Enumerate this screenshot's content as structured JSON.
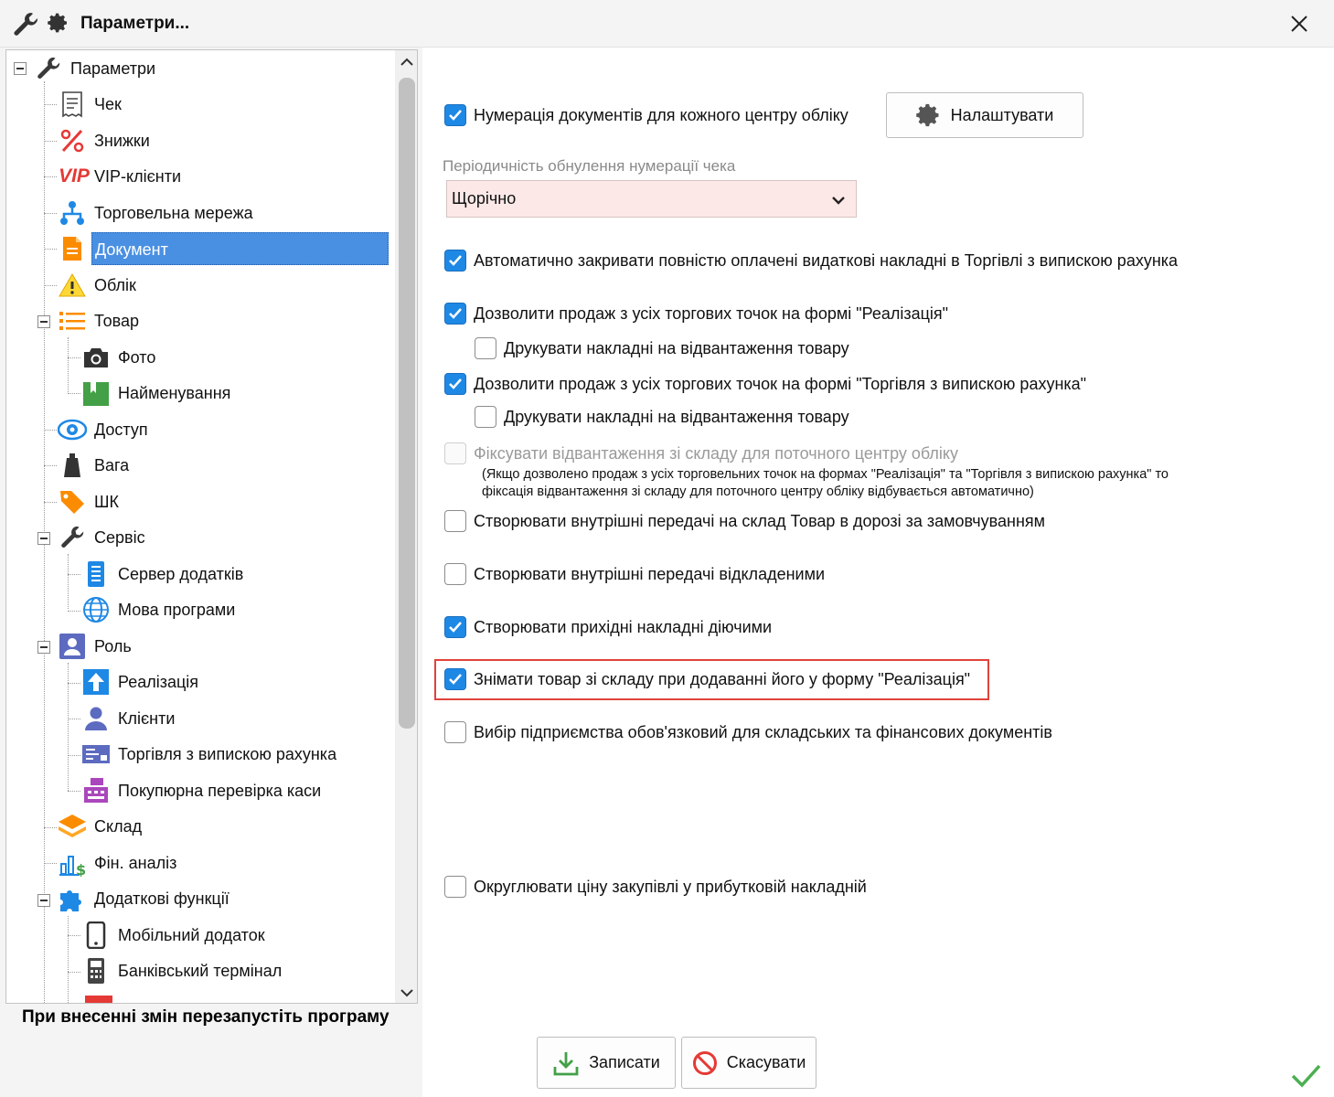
{
  "window": {
    "title": "Параметри...",
    "icons": [
      "wrench-icon",
      "gear-icon",
      "close-icon"
    ]
  },
  "tree": {
    "items": [
      {
        "label": "Параметри",
        "icon": "wrench-icon"
      },
      {
        "label": "Чек",
        "icon": "receipt-icon"
      },
      {
        "label": "Знижки",
        "icon": "percent-icon"
      },
      {
        "label": "VIP-клієнти",
        "icon": "vip-icon",
        "icon_text": "VIP"
      },
      {
        "label": "Торговельна мережа",
        "icon": "network-icon"
      },
      {
        "label": "Документ",
        "icon": "document-icon",
        "selected": true
      },
      {
        "label": "Облік",
        "icon": "warning-icon"
      },
      {
        "label": "Товар",
        "icon": "list-icon"
      },
      {
        "label": "Фото",
        "icon": "camera-icon"
      },
      {
        "label": "Найменування",
        "icon": "name-tag-icon"
      },
      {
        "label": "Доступ",
        "icon": "eye-icon"
      },
      {
        "label": "Вага",
        "icon": "weight-icon"
      },
      {
        "label": "ШК",
        "icon": "tag-icon"
      },
      {
        "label": "Сервіс",
        "icon": "wrench-icon"
      },
      {
        "label": "Сервер додатків",
        "icon": "server-icon"
      },
      {
        "label": "Мова програми",
        "icon": "globe-icon"
      },
      {
        "label": "Роль",
        "icon": "user-card-icon"
      },
      {
        "label": "Реалізація",
        "icon": "upload-icon"
      },
      {
        "label": "Клієнти",
        "icon": "user-icon"
      },
      {
        "label": "Торгівля з випискою рахунка",
        "icon": "invoice-icon"
      },
      {
        "label": "Покупюрна перевірка каси",
        "icon": "cash-register-icon"
      },
      {
        "label": "Склад",
        "icon": "layers-icon"
      },
      {
        "label": "Фін. аналіз",
        "icon": "chart-dollar-icon"
      },
      {
        "label": "Додаткові функції",
        "icon": "puzzle-icon"
      },
      {
        "label": "Мобільний додаток",
        "icon": "phone-icon"
      },
      {
        "label": "Банківський термінал",
        "icon": "terminal-icon"
      }
    ]
  },
  "restart_note": "При внесенні змін перезапустіть програму",
  "settings": {
    "numbering_label": "Нумерація документів для кожного центру обліку",
    "numbering_checked": true,
    "configure_button": "Налаштувати",
    "period_label": "Періодичність обнулення нумерації чека",
    "period_value": "Щорічно",
    "auto_close_label": "Автоматично закривати повністю оплачені видаткові накладні в Торгівлі з випискою рахунка",
    "allow_sale_realization_label": "Дозволити продаж з усіх торгових точок на формі \"Реалізація\"",
    "print_invoices_1_label": "Друкувати накладні на відвантаження товару",
    "allow_sale_trade_label": "Дозволити продаж з усіх торгових точок на формі \"Торгівля з випискою рахунка\"",
    "print_invoices_2_label": "Друкувати накладні на відвантаження товару",
    "fix_shipment_label": "Фіксувати відвантаження зі складу для поточного центру обліку",
    "fix_shipment_note_1": "(Якщо дозволено продаж з усіх торговельних точок на формах \"Реалізація\" та \"Торгівля з випискою рахунка\" то",
    "fix_shipment_note_2": "фіксація відвантаження зі складу для поточного центру обліку відбувається автоматично)",
    "internal_transit_label": "Створювати внутрішні передачі на склад Товар в дорозі за замовчуванням",
    "internal_deferred_label": "Створювати внутрішні передачі відкладеними",
    "incoming_active_label": "Створювати прихідні накладні діючими",
    "remove_stock_label": "Знімати товар зі складу при додаванні його у форму \"Реалізація\"",
    "enterprise_required_label": "Вибір підприємства обов'язковий для складських та фінансових документів",
    "round_price_label": "Округлювати ціну закупівлі у прибутковій накладній"
  },
  "buttons": {
    "save": "Записати",
    "cancel": "Скасувати"
  },
  "colors": {
    "accent": "#1e88e5",
    "selection": "#4a90e2",
    "highlight_border": "#e0433a",
    "select_bg": "#fde8e8",
    "ok_check": "#4caf50"
  }
}
